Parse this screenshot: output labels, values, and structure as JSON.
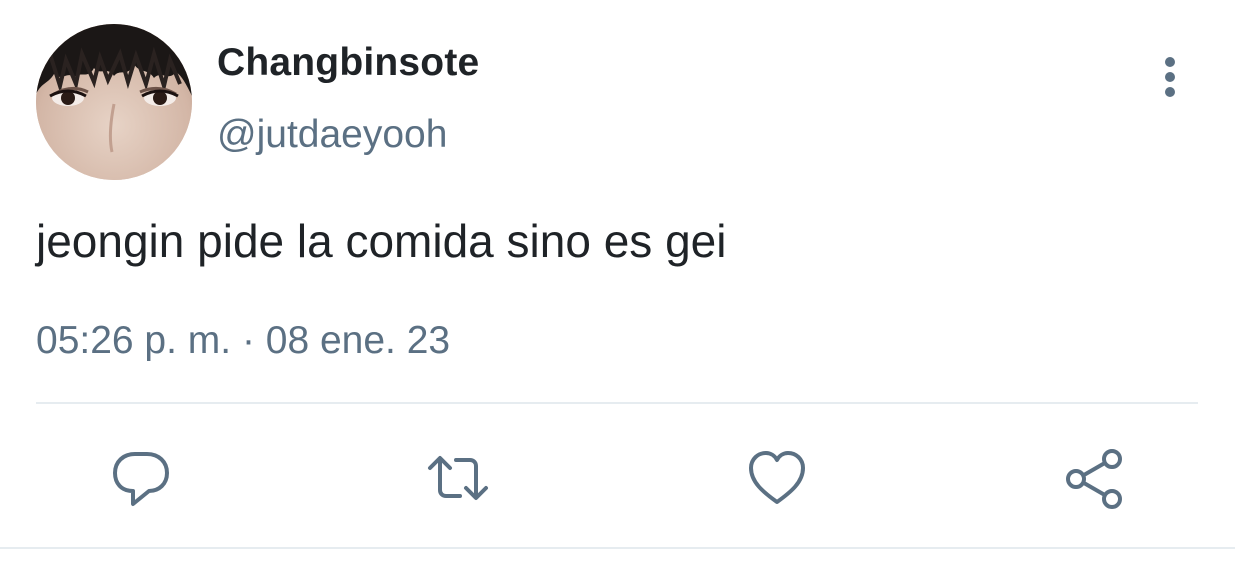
{
  "tweet": {
    "author": {
      "display_name": "Changbinsote",
      "handle": "@jutdaeyooh",
      "avatar_icon": "profile-photo"
    },
    "text": "jeongin pide la comida sino es gei",
    "timestamp": "05:26 p. m. · 08 ene. 23",
    "more_icon": "vertical-ellipsis-icon"
  },
  "actions": [
    {
      "name": "reply",
      "icon": "speech-bubble-icon"
    },
    {
      "name": "retweet",
      "icon": "retweet-arrows-icon"
    },
    {
      "name": "like",
      "icon": "heart-icon"
    },
    {
      "name": "share",
      "icon": "share-nodes-icon"
    }
  ],
  "colors": {
    "text_primary": "#1f2327",
    "text_secondary": "#5b7083",
    "icon": "#5b7083",
    "divider": "#e6ecf0",
    "background": "#ffffff"
  }
}
